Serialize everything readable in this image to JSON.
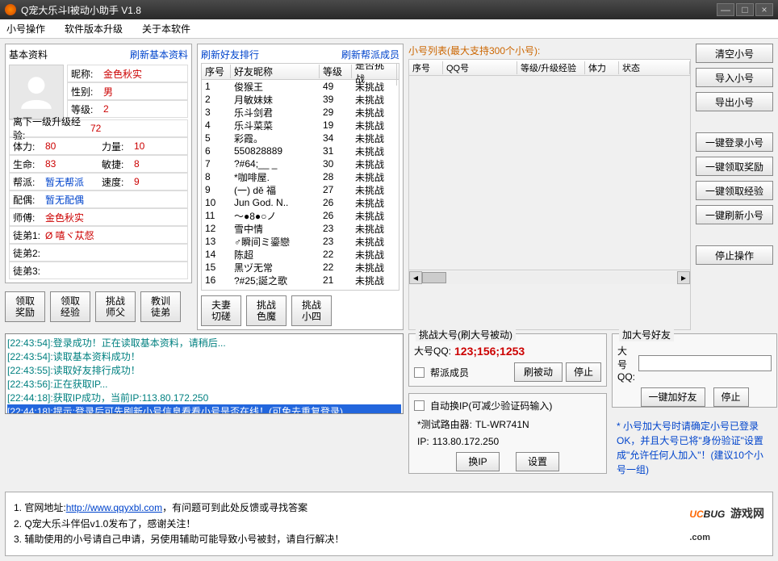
{
  "window": {
    "title": "Q宠大乐斗Ⅰ被动小助手 V1.8"
  },
  "menu": {
    "m1": "小号操作",
    "m2": "软件版本升级",
    "m3": "关于本软件"
  },
  "basic": {
    "title": "基本资料",
    "refresh": "刷新基本资料",
    "nick_lbl": "昵称:",
    "nick": "金色秋实",
    "gender_lbl": "性别:",
    "gender": "男",
    "level_lbl": "等级:",
    "level": "2",
    "nextexp_lbl": "离下一级升级经验:",
    "nextexp": "72",
    "hp_lbl": "体力:",
    "hp": "80",
    "str_lbl": "力量:",
    "str": "10",
    "life_lbl": "生命:",
    "life": "83",
    "agi_lbl": "敏捷:",
    "agi": "8",
    "gang_lbl": "帮派:",
    "gang": "暂无帮派",
    "spd_lbl": "速度:",
    "spd": "9",
    "spouse_lbl": "配偶:",
    "spouse": "暂无配偶",
    "master_lbl": "师傅:",
    "master": "金色秋实",
    "d1_lbl": "徒弟1:",
    "d1": "Ø 嘻ヾ苁惄",
    "d2_lbl": "徒弟2:",
    "d2": "",
    "d3_lbl": "徒弟3:",
    "d3": ""
  },
  "actions": {
    "b1": "领取\n奖励",
    "b2": "领取\n经验",
    "b3": "挑战\n师父",
    "b4": "教训\n徒弟",
    "b5": "夫妻\n切磋",
    "b6": "挑战\n色魔",
    "b7": "挑战\n小四"
  },
  "friends": {
    "refresh": "刷新好友排行",
    "refresh2": "刷新帮派成员",
    "h_idx": "序号",
    "h_name": "好友昵称",
    "h_lvl": "等级",
    "h_chl": "是否挑战",
    "rows": [
      {
        "i": "1",
        "n": "俊猴王",
        "l": "49",
        "c": "未挑战"
      },
      {
        "i": "2",
        "n": "月敏妹妹",
        "l": "39",
        "c": "未挑战"
      },
      {
        "i": "3",
        "n": "乐斗剑君",
        "l": "29",
        "c": "未挑战"
      },
      {
        "i": "4",
        "n": "乐斗菜菜",
        "l": "19",
        "c": "未挑战"
      },
      {
        "i": "5",
        "n": "彩霞。",
        "l": "34",
        "c": "未挑战"
      },
      {
        "i": "6",
        "n": "550828889",
        "l": "31",
        "c": "未挑战"
      },
      {
        "i": "7",
        "n": "?#64;__ _",
        "l": "30",
        "c": "未挑战"
      },
      {
        "i": "8",
        "n": "*咖啡屋.",
        "l": "28",
        "c": "未挑战"
      },
      {
        "i": "9",
        "n": "(一) dě 福",
        "l": "27",
        "c": "未挑战"
      },
      {
        "i": "10",
        "n": "Jun God. N..",
        "l": "26",
        "c": "未挑战"
      },
      {
        "i": "11",
        "n": "～●8●○ノ",
        "l": "26",
        "c": "未挑战"
      },
      {
        "i": "12",
        "n": "雪中情",
        "l": "23",
        "c": "未挑战"
      },
      {
        "i": "13",
        "n": "♂瞬间ミ鎏戀",
        "l": "23",
        "c": "未挑战"
      },
      {
        "i": "14",
        "n": "陈超",
        "l": "22",
        "c": "未挑战"
      },
      {
        "i": "15",
        "n": "黑ヅ无常",
        "l": "22",
        "c": "未挑战"
      },
      {
        "i": "16",
        "n": "?#25;誕之歌",
        "l": "21",
        "c": "未挑战"
      }
    ]
  },
  "altlist": {
    "title": "小号列表(最大支持300个小号):",
    "h_idx": "序号",
    "h_qq": "QQ号",
    "h_exp": "等级/升级经验",
    "h_hp": "体力",
    "h_st": "状态"
  },
  "rightbtns": {
    "b1": "清空小号",
    "b2": "导入小号",
    "b3": "导出小号",
    "b4": "一键登录小号",
    "b5": "一键领取奖励",
    "b6": "一键领取经验",
    "b7": "一键刷新小号",
    "b8": "停止操作"
  },
  "log": {
    "l1": "[22:43:54]:登录成功！正在读取基本资料，请稍后...",
    "l2": "[22:43:54]:读取基本资料成功！",
    "l3": "[22:43:55]:读取好友排行成功！",
    "l4": "[22:43:56]:正在获取IP...",
    "l5": "[22:44:18]:获取IP成功，当前IP:113.80.172.250",
    "l6": "[22:44:18]:提示:登录后可先刷新小号信息看看小号是否在线！(可免去重复登录)"
  },
  "challenge": {
    "title": "挑战大号(刷大号被动)",
    "qq_lbl": "大号QQ:",
    "qq_val": "123;156;1253",
    "chk": "帮派成员",
    "btn1": "刷被动",
    "btn2": "停止"
  },
  "addfriend": {
    "title": "加大号好友",
    "qq_lbl": "大号QQ:",
    "btn1": "一键加好友",
    "btn2": "停止"
  },
  "autoip": {
    "chk": "自动换IP(可减少验证码输入)",
    "router_lbl": "*测试路由器:",
    "router": "TL-WR741N",
    "ip_lbl": "IP:",
    "ip": "113.80.172.250",
    "btn1": "换IP",
    "btn2": "设置"
  },
  "note": "* 小号加大号时请确定小号已登录OK，并且大号已将\"身份验证\"设置成\"允许任何人加入\"！(建议10个小号一组)",
  "footer": {
    "n1_pre": "1. 官网地址:",
    "n1_url": "http://www.qqyxbl.com",
    "n1_post": "，有问题可到此处反馈或寻找答案",
    "n2": "2. Q宠大乐斗伴侣v1.0发布了，感谢关注！",
    "n3": "3. 辅助使用的小号请自己申请，另使用辅助可能导致小号被封，请自行解决！",
    "logo1": "UC",
    "logo2": "BUG",
    "logo3": "游戏网",
    "logo4": ".com"
  }
}
